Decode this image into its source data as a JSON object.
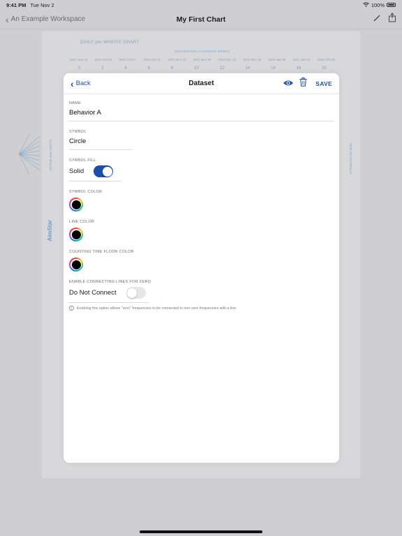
{
  "status_bar": {
    "time": "9:41 PM",
    "date": "Tue Nov 2",
    "battery": "100%"
  },
  "navbar": {
    "back_label": "An Example Workspace",
    "title": "My First Chart"
  },
  "chart": {
    "title": "DAILY per MINUTE CHART",
    "subtitle": "SUCCESSIVE CALENDAR WEEKS",
    "dates": [
      "2021 Sep 19",
      "2021 Oct 03",
      "2021 Oct 17",
      "2021 Oct 31",
      "2021 Nov 14",
      "2021 Nov 28",
      "2021 Dec 12",
      "2021 Dec 26",
      "2022 Jan 09",
      "2022 Jan 23",
      "2022 Feb 06"
    ],
    "numbers": [
      "0",
      "2",
      "4",
      "6",
      "8",
      "10",
      "12",
      "14",
      "16",
      "18",
      "20"
    ],
    "left_axis_label": "COUNT PER MINUTE",
    "right_axis_label": "TIME ON SCHEDULE",
    "logo": "AimStar"
  },
  "modal": {
    "back_label": "Back",
    "title": "Dataset",
    "save_label": "SAVE",
    "name": {
      "label": "NAME",
      "value": "Behavior A"
    },
    "symbol": {
      "label": "SYMBOL",
      "value": "Circle"
    },
    "symbol_fill": {
      "label": "SYMBOL FILL",
      "value": "Solid",
      "enabled": true
    },
    "symbol_color": {
      "label": "SYMBOL COLOR",
      "color": "#000000"
    },
    "line_color": {
      "label": "LINE COLOR",
      "color": "#000000"
    },
    "floor_color": {
      "label": "COUNTING TIME FLOOR COLOR",
      "color": "#000000"
    },
    "connecting_lines": {
      "label": "ENABLE CONNECTING LINES FOR ZERO",
      "value": "Do Not Connect",
      "enabled": false,
      "help": "Enabling this option allows \"zero\" frequencies to be connected to non-zero frequencies with a line."
    }
  },
  "colors": {
    "accent": "#1e4fa8",
    "toggle_off": "#e6e6e9"
  }
}
